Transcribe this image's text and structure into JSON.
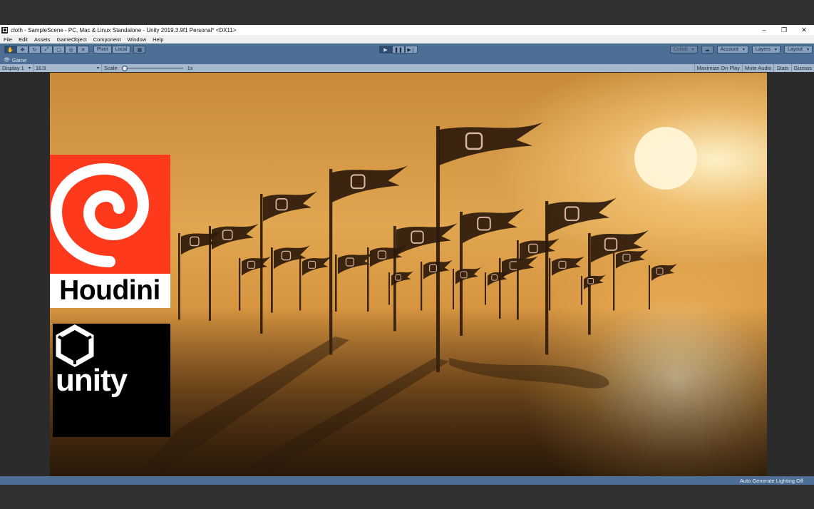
{
  "window": {
    "title": "cloth - SampleScene - PC, Mac & Linux Standalone - Unity 2019.3.9f1 Personal* <DX11>",
    "controls": {
      "minimize": "–",
      "maximize": "❐",
      "close": "✕"
    }
  },
  "menu": [
    "File",
    "Edit",
    "Assets",
    "GameObject",
    "Component",
    "Window",
    "Help"
  ],
  "toolbar": {
    "pivot_label": "Pivot",
    "local_label": "Local",
    "collab_label": "Collab",
    "account_label": "Account",
    "layers_label": "Layers",
    "layout_label": "Layout"
  },
  "game_tab": {
    "label": "Game"
  },
  "game_bar": {
    "display": "Display 1",
    "aspect": "16:9",
    "scale_label": "Scale",
    "scale_value": "1x",
    "maximize_on_play": "Maximize On Play",
    "mute_audio": "Mute Audio",
    "stats": "Stats",
    "gizmos": "Gizmos"
  },
  "status": {
    "lighting": "Auto Generate Lighting Off"
  },
  "overlays": {
    "houdini_text": "Houdini",
    "unity_text": "unity"
  },
  "colors": {
    "unity_toolbar": "#4e6f95",
    "houdini_red": "#ff3a1c",
    "sky_gold": "#e1a650"
  },
  "icons": [
    "hand-tool-icon",
    "move-tool-icon",
    "rotate-tool-icon",
    "scale-tool-icon",
    "rect-tool-icon",
    "transform-tool-icon",
    "custom-tool-icon",
    "play-icon",
    "pause-icon",
    "step-icon",
    "cloud-icon",
    "game-view-icon"
  ]
}
